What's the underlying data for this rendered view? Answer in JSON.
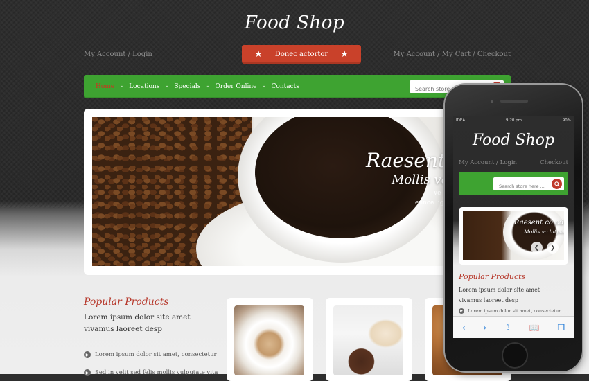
{
  "site": {
    "logo": "Food Shop",
    "account_link": "My Account / Login",
    "cart_link": "My Account / My Cart / Checkout",
    "promo": "Donec actortor",
    "promo_icon": "star-icon"
  },
  "nav": {
    "items": [
      "Home",
      "Locations",
      "Specials",
      "Order Online",
      "Contacts"
    ],
    "separator": "-",
    "active_color": "#c7361f",
    "bg_color": "#3ea331",
    "search_placeholder": "Search store here ..."
  },
  "hero": {
    "title": "Raesent co",
    "subtitle": "Mollis vo",
    "line1": "ve",
    "line2": "ennce lig"
  },
  "popular": {
    "title": "Popular Products",
    "intro_line1": "Lorem ipsum dolor site amet",
    "intro_line2": "vivamus laoreet desp",
    "bullets": [
      "Lorem ipsum dolor sit amet, consectetur",
      "Sed in velit sed felis mollis vulputate vita"
    ]
  },
  "mobile": {
    "status": {
      "carrier": "IDEA",
      "time": "9:20 pm",
      "battery": "90%"
    },
    "logo": "Food Shop",
    "account_link": "My Account / Login",
    "checkout_link": "Checkout",
    "search_placeholder": "Search store here ...",
    "slider_title": "Raesent co odo",
    "slider_subtitle": "Mollis vo lutpat",
    "section_title": "Popular Products",
    "intro_line1": "Lorem ipsum dolor site amet",
    "intro_line2": "vivamus laoreet desp",
    "bullet": "Lorem ipsum dolor sit amet, consectetur",
    "toolbar_icons": [
      "back-icon",
      "forward-icon",
      "share-icon",
      "bookmarks-icon",
      "tabs-icon"
    ]
  },
  "colors": {
    "accent_red": "#c9412a",
    "brand_green": "#3ea331",
    "title_red": "#b6372a"
  }
}
